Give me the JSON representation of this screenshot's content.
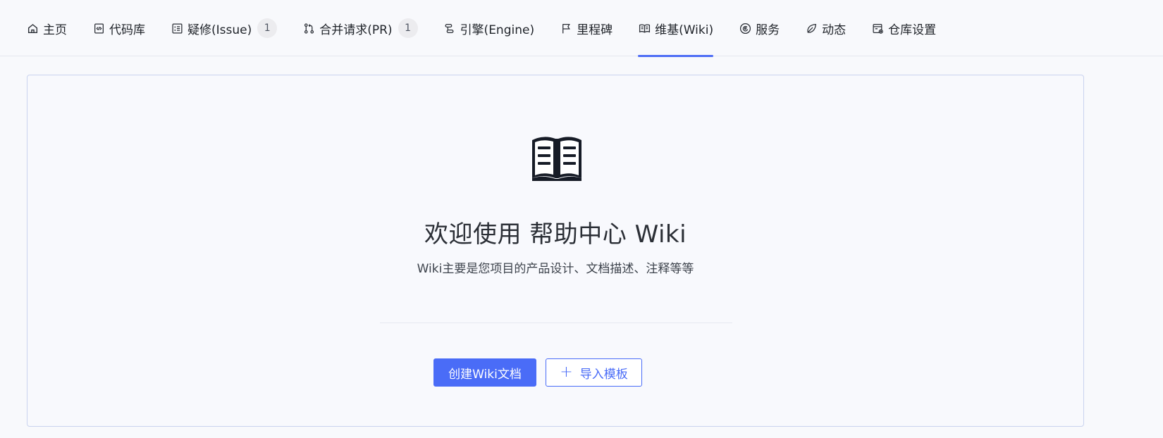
{
  "nav": {
    "tabs": [
      {
        "label": "主页",
        "icon": "home-icon"
      },
      {
        "label": "代码库",
        "icon": "code-file-icon"
      },
      {
        "label": "疑修(Issue)",
        "icon": "issue-list-icon",
        "badge": "1"
      },
      {
        "label": "合并请求(PR)",
        "icon": "pull-request-icon",
        "badge": "1"
      },
      {
        "label": "引擎(Engine)",
        "icon": "engine-icon"
      },
      {
        "label": "里程碑",
        "icon": "flag-icon"
      },
      {
        "label": "维基(Wiki)",
        "icon": "book-icon",
        "active": true
      },
      {
        "label": "服务",
        "icon": "service-icon"
      },
      {
        "label": "动态",
        "icon": "leaf-icon"
      },
      {
        "label": "仓库设置",
        "icon": "settings-icon"
      }
    ]
  },
  "wiki": {
    "title": "欢迎使用 帮助中心 Wiki",
    "subtitle": "Wiki主要是您项目的产品设计、文档描述、注释等等",
    "create_button": "创建Wiki文档",
    "import_button": "导入模板",
    "import_icon": "+"
  },
  "colors": {
    "accent": "#4a6cf7",
    "active_underline": "#4d6cf5",
    "badge_bg": "#ececef"
  }
}
